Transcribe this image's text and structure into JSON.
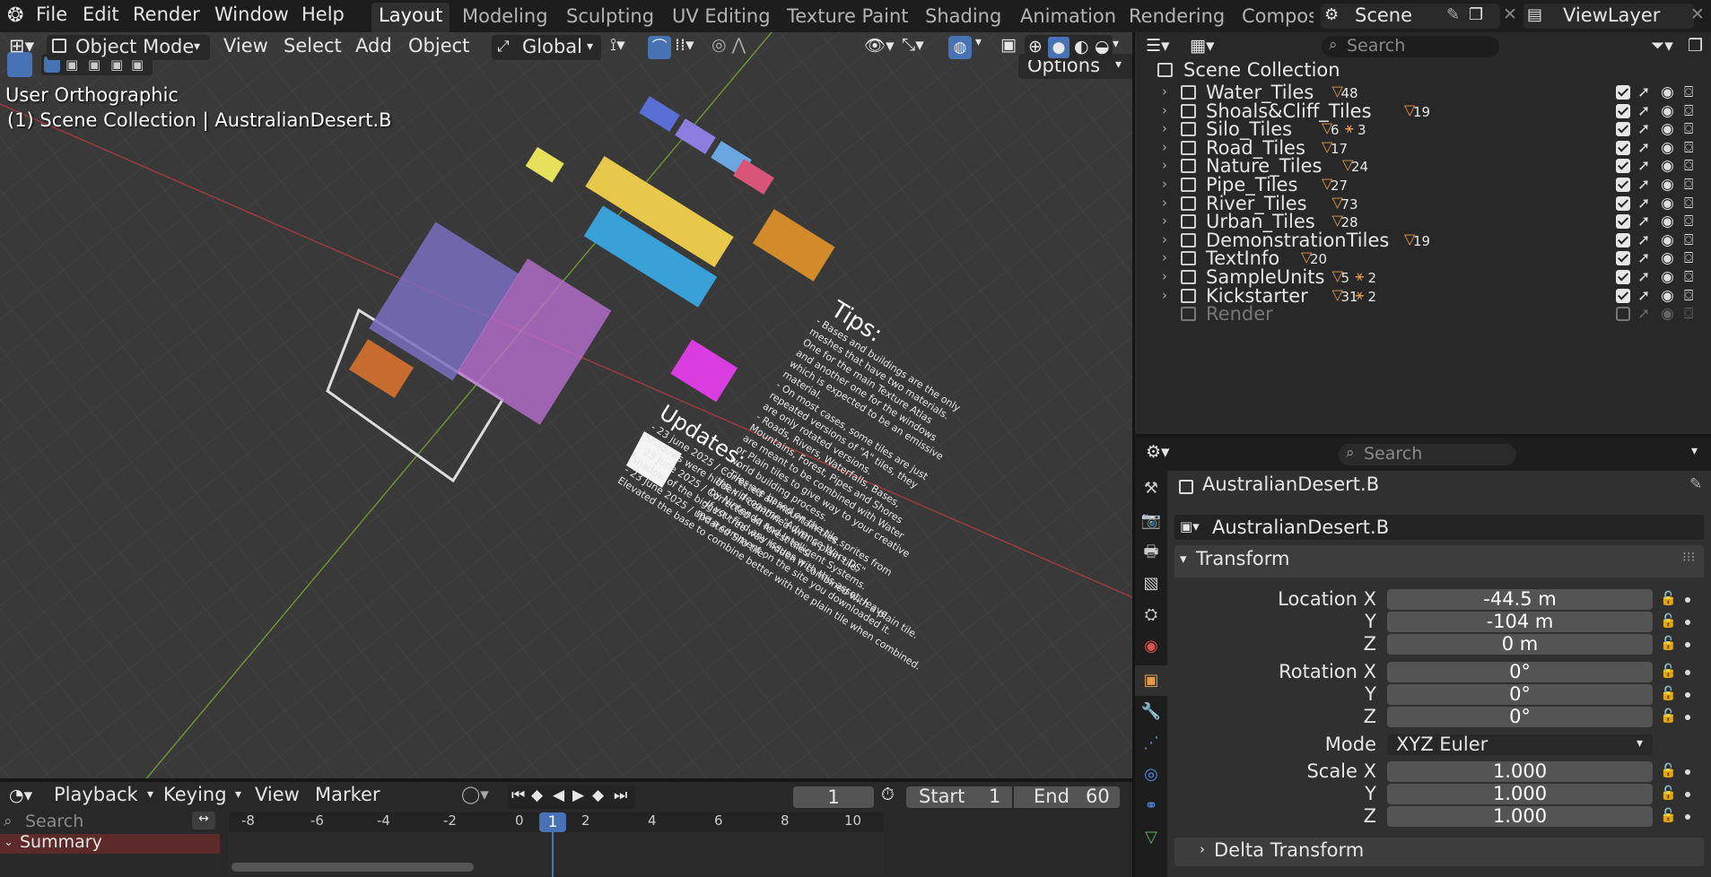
{
  "topbar": {
    "menus": [
      "File",
      "Edit",
      "Render",
      "Window",
      "Help"
    ],
    "workspace_tabs": [
      "Layout",
      "Modeling",
      "Sculpting",
      "UV Editing",
      "Texture Paint",
      "Shading",
      "Animation",
      "Rendering",
      "Compos"
    ],
    "active_tab": "Layout",
    "scene_name": "Scene",
    "view_layer": "ViewLayer"
  },
  "viewport_header": {
    "mode": "Object Mode",
    "menus": [
      "View",
      "Select",
      "Add",
      "Object"
    ],
    "transform_orientation": "Global",
    "options_label": "Options"
  },
  "viewport": {
    "view_name": "User Orthographic",
    "active_info": "(1) Scene Collection | AustralianDesert.B",
    "tips_title": "Tips:",
    "tips_lines": [
      "- Bases and buildings are the only",
      "meshes that have two materials.",
      "One for the main Texture Atlas",
      "and another one for the windows",
      "which is expected to be an emissive",
      "material.",
      "- On most cases, some tiles are just",
      "repeated versions of \"A\" tiles, they",
      "are only rotated versions.",
      "- Roads, Rivers, Waterfalls, Bases,",
      "Mountains, Forest, Pipes and Shores",
      "are meant to be combined with Water",
      "or Plain tiles to give way to your creative",
      "world building process.",
      "- Tiles are based on the tile sprites from",
      "the videogame \"Advance Wars DS\"",
      "by Nintendo and Intelligent Systems.",
      "-If you find any issues with this asset, leave",
      "me a comment on the site you downloaded it."
    ],
    "updates_title": "Updates:",
    "updates_lines": [
      "- 23 june 2025 / Corrected all mountain tiles.",
      "Shadows were hidden if combined with a plain tile.",
      "- 23 June 2025 / Corrected all forest tiles.",
      "Shadow of the biggest tree was hidden if combined with a plain tile.",
      "- 23 June 2025 / updated Silo tile.",
      "Elevated the base to combine better with the plain tile when combined."
    ]
  },
  "outliner": {
    "search_placeholder": "Search",
    "root": "Scene Collection",
    "collections": [
      {
        "name": "Water_Tiles",
        "count": "48",
        "enabled": true
      },
      {
        "name": "Shoals&Cliff_Tiles",
        "count": "19",
        "enabled": true
      },
      {
        "name": "Silo_Tiles",
        "count": "6",
        "count2": "3",
        "enabled": true
      },
      {
        "name": "Road_Tiles",
        "count": "17",
        "enabled": true
      },
      {
        "name": "Nature_Tiles",
        "count": "24",
        "enabled": true
      },
      {
        "name": "Pipe_Tiles",
        "count": "27",
        "enabled": true
      },
      {
        "name": "River_Tiles",
        "count": "73",
        "enabled": true
      },
      {
        "name": "Urban_Tiles",
        "count": "28",
        "enabled": true
      },
      {
        "name": "DemonstrationTiles",
        "count": "19",
        "enabled": true
      },
      {
        "name": "TextInfo",
        "count": "20",
        "enabled": true
      },
      {
        "name": "SampleUnits",
        "count": "5",
        "count2": "2",
        "enabled": true
      },
      {
        "name": "Kickstarter",
        "count": "31",
        "count2": "2",
        "enabled": true
      },
      {
        "name": "Render",
        "count": "",
        "enabled": false
      }
    ]
  },
  "properties": {
    "search_placeholder": "Search",
    "object_name": "AustralianDesert.B",
    "data_name": "AustralianDesert.B",
    "transform_label": "Transform",
    "location": {
      "label": "Location X",
      "x": "-44.5 m",
      "y": "-104 m",
      "z": "0 m"
    },
    "rotation": {
      "label": "Rotation X",
      "x": "0°",
      "y": "0°",
      "z": "0°"
    },
    "mode_label": "Mode",
    "mode_value": "XYZ Euler",
    "scale": {
      "label": "Scale X",
      "x": "1.000",
      "y": "1.000",
      "z": "1.000"
    },
    "y_label": "Y",
    "z_label": "Z",
    "delta_label": "Delta Transform"
  },
  "timeline": {
    "menus": [
      "Playback",
      "Keying",
      "View",
      "Marker"
    ],
    "current_frame": "1",
    "start_label": "Start",
    "start_value": "1",
    "end_label": "End",
    "end_value": "60",
    "search_placeholder": "Search",
    "summary": "Summary",
    "ruler": [
      "-8",
      "-6",
      "-4",
      "-2",
      "0",
      "2",
      "4",
      "6",
      "8",
      "10"
    ],
    "playhead": "1"
  },
  "colors": {
    "accent": "#4772b3",
    "collection_icon": "#e69a47",
    "x_axis": "#a33b3b",
    "y_axis": "#6b9933",
    "summary_bg": "#5c2a2a"
  }
}
